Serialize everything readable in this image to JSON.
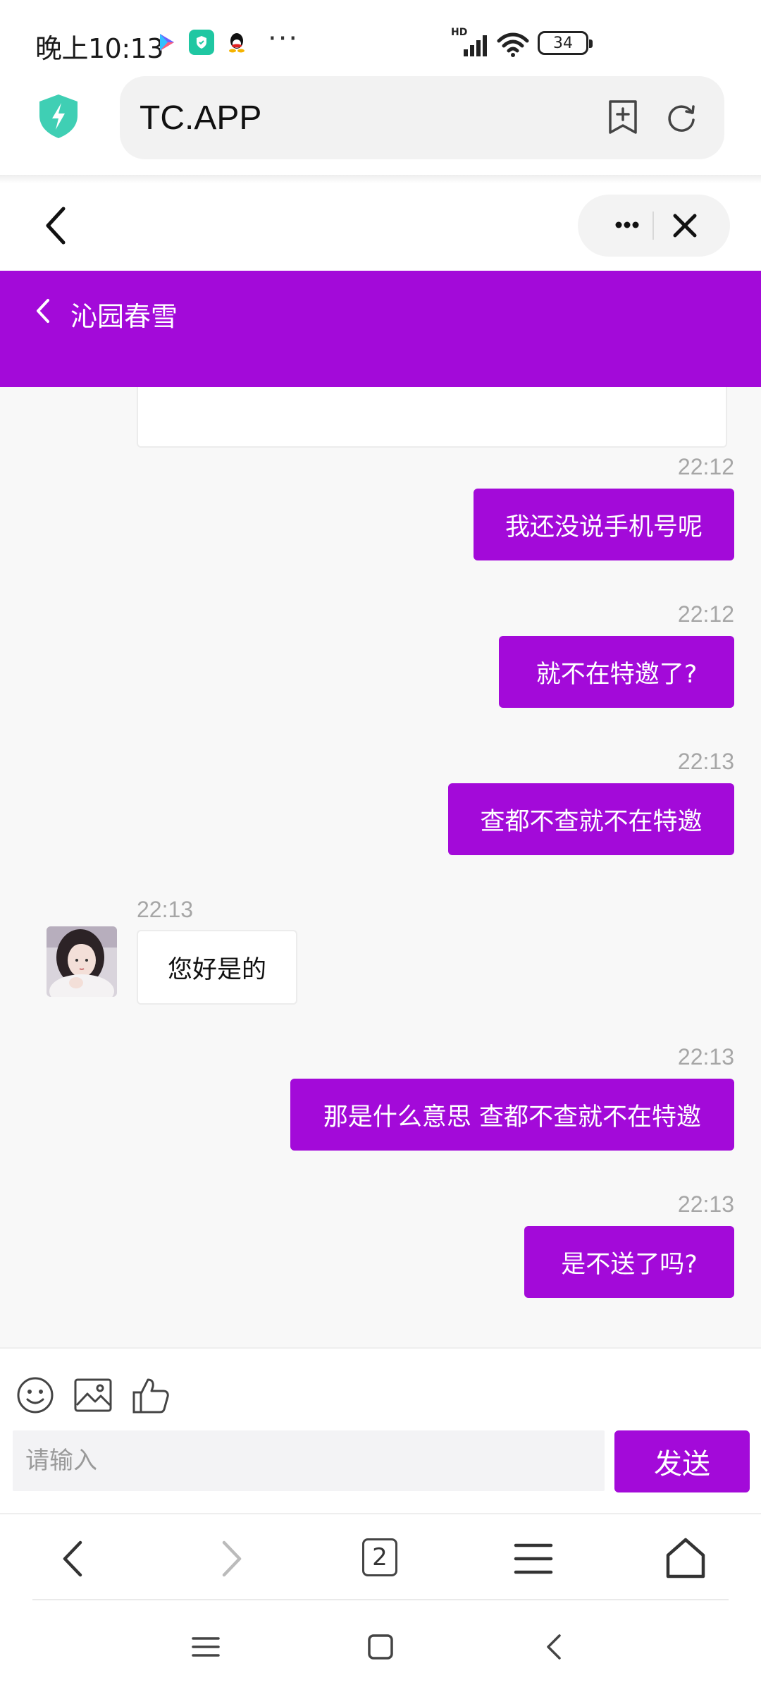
{
  "status_bar": {
    "time": "晚上10:13",
    "more": "···",
    "network_label": "HD",
    "battery": "34"
  },
  "browser": {
    "url": "TC.APP",
    "tab_count": "2"
  },
  "chat": {
    "title": "沁园春雪",
    "messages": [
      {
        "time": "22:12",
        "text": "我还没说手机号呢",
        "direction": "out"
      },
      {
        "time": "22:12",
        "text": "就不在特邀了?",
        "direction": "out"
      },
      {
        "time": "22:13",
        "text": "查都不查就不在特邀",
        "direction": "out"
      },
      {
        "time": "22:13",
        "text": "您好是的",
        "direction": "in"
      },
      {
        "time": "22:13",
        "text": "那是什么意思 查都不查就不在特邀",
        "direction": "out"
      },
      {
        "time": "22:13",
        "text": "是不送了吗?",
        "direction": "out"
      }
    ]
  },
  "composer": {
    "placeholder": "请输入",
    "send_label": "发送"
  },
  "colors": {
    "accent": "#a30ad9",
    "background": "#f8f8f8"
  },
  "icons": [
    "emoji-icon",
    "image-icon",
    "thumbs-up-icon",
    "shield-icon",
    "bookmark-add-icon",
    "refresh-icon",
    "more-icon",
    "close-icon",
    "back-icon",
    "forward-icon",
    "menu-icon",
    "home-icon"
  ]
}
